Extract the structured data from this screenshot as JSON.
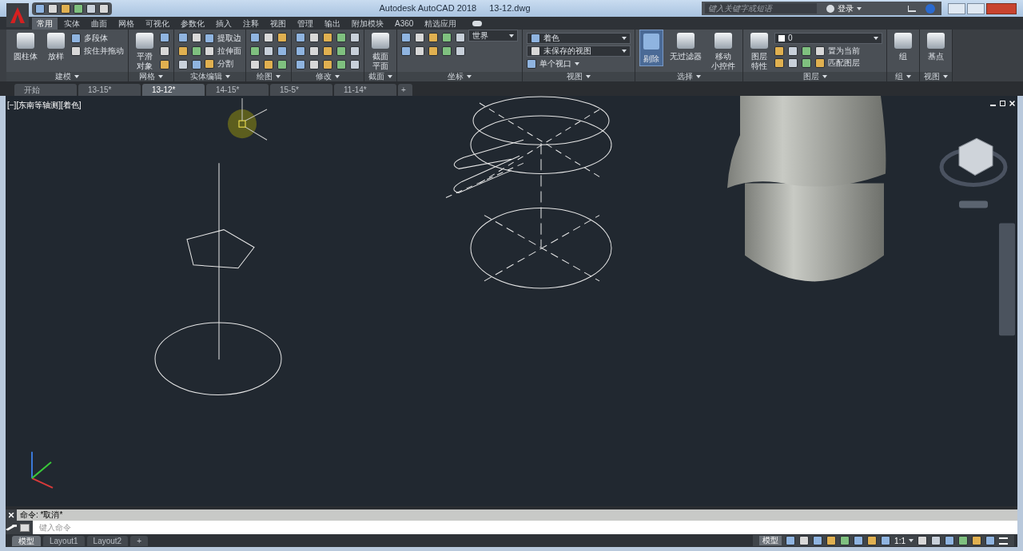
{
  "title_bar": {
    "app": "Autodesk AutoCAD 2018",
    "file": "13-12.dwg",
    "search": {
      "placeholder": "键入关键字或短语"
    },
    "login": "登录"
  },
  "ribbon_tabs": [
    {
      "label": "常用",
      "selected": true
    },
    {
      "label": "实体",
      "selected": false
    },
    {
      "label": "曲面",
      "selected": false
    },
    {
      "label": "网格",
      "selected": false
    },
    {
      "label": "可视化",
      "selected": false
    },
    {
      "label": "参数化",
      "selected": false
    },
    {
      "label": "插入",
      "selected": false
    },
    {
      "label": "注释",
      "selected": false
    },
    {
      "label": "视图",
      "selected": false
    },
    {
      "label": "管理",
      "selected": false
    },
    {
      "label": "输出",
      "selected": false
    },
    {
      "label": "附加模块",
      "selected": false
    },
    {
      "label": "A360",
      "selected": false
    },
    {
      "label": "精选应用",
      "selected": false
    }
  ],
  "panels": [
    {
      "title": "建模",
      "items": [
        {
          "kind": "large",
          "lines": [
            "圆柱体"
          ]
        },
        {
          "kind": "large",
          "lines": [
            "放样"
          ]
        },
        {
          "kind": "smalls",
          "labels": [
            "多段体",
            "按住并拖动"
          ]
        }
      ]
    },
    {
      "title": "网格",
      "items": [
        {
          "kind": "large",
          "lines": [
            "平滑",
            "对象"
          ]
        },
        {
          "kind": "icons"
        }
      ]
    },
    {
      "title": "实体编辑",
      "items": [
        {
          "kind": "icons"
        },
        {
          "kind": "smalls",
          "labels": [
            "提取边",
            "拉伸面",
            "分割"
          ]
        }
      ]
    },
    {
      "title": "绘图",
      "items": [
        {
          "kind": "icons"
        }
      ]
    },
    {
      "title": "修改",
      "items": [
        {
          "kind": "icons"
        }
      ]
    },
    {
      "title": "截面",
      "items": [
        {
          "kind": "large",
          "lines": [
            "截面",
            "平面"
          ]
        }
      ]
    },
    {
      "title": "坐标",
      "items": [
        {
          "kind": "icons"
        },
        {
          "kind": "combo",
          "value": "世界"
        }
      ]
    },
    {
      "title": "视图",
      "items": [
        {
          "kind": "combos",
          "values": [
            "着色",
            "未保存的视图"
          ],
          "link": "单个视口"
        }
      ]
    },
    {
      "title": "选择",
      "items": [
        {
          "kind": "toggle",
          "label": "剔除",
          "selected": true
        },
        {
          "kind": "large",
          "lines": [
            "无过滤器"
          ]
        },
        {
          "kind": "large",
          "lines": [
            "移动",
            "小控件"
          ]
        }
      ]
    },
    {
      "title": "图层",
      "items": [
        {
          "kind": "large",
          "lines": [
            "图层",
            "特性"
          ]
        },
        {
          "kind": "layers",
          "value": "0",
          "labels": [
            "置为当前",
            "匹配图层"
          ]
        }
      ]
    },
    {
      "title": "组",
      "items": [
        {
          "kind": "large",
          "lines": [
            "组"
          ]
        }
      ]
    },
    {
      "title": "视图",
      "items": [
        {
          "kind": "large",
          "lines": [
            "基点"
          ]
        }
      ]
    }
  ],
  "file_tabs": [
    {
      "label": "开始",
      "selected": false
    },
    {
      "label": "13-15*",
      "selected": false
    },
    {
      "label": "13-12*",
      "selected": true
    },
    {
      "label": "14-15*",
      "selected": false
    },
    {
      "label": "15-5*",
      "selected": false
    },
    {
      "label": "11-14*",
      "selected": false
    },
    {
      "label": "+",
      "selected": false
    }
  ],
  "viewport": {
    "label": "[−][东南等轴测][着色]"
  },
  "command_line": {
    "history": "命令: *取消*",
    "placeholder": "键入命令"
  },
  "layout_tabs": [
    {
      "label": "模型",
      "selected": true
    },
    {
      "label": "Layout1",
      "selected": false
    },
    {
      "label": "Layout2",
      "selected": false
    },
    {
      "label": "+",
      "selected": false
    }
  ],
  "status_bar": {
    "space": "模型",
    "scale": "1:1"
  }
}
